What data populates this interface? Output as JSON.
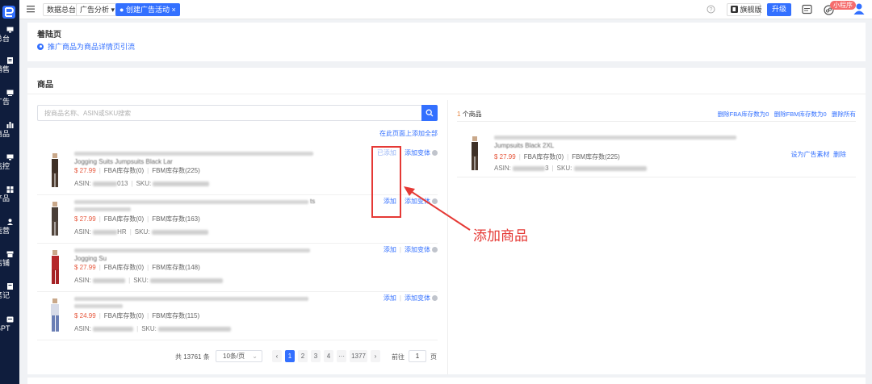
{
  "sidebar": {
    "items": [
      {
        "label": "总台",
        "icon": "monitor-icon"
      },
      {
        "label": "销售",
        "icon": "doc-icon"
      },
      {
        "label": "广告",
        "icon": "screen-icon"
      },
      {
        "label": "商品",
        "icon": "chart-icon"
      },
      {
        "label": "监控",
        "icon": "monitor-icon"
      },
      {
        "label": "产品",
        "icon": "grid-icon"
      },
      {
        "label": "运营",
        "icon": "user-icon"
      },
      {
        "label": "店铺",
        "icon": "store-icon"
      },
      {
        "label": "笔记",
        "icon": "note-icon"
      },
      {
        "label": "GPT",
        "icon": "gpt-icon"
      }
    ]
  },
  "topbar": {
    "crumbs": [
      "数据总台",
      "广告分析",
      "创建广告活动"
    ],
    "edition_label": "旗舰版",
    "upgrade_label": "升级",
    "mini_program_label": "小程序"
  },
  "landing": {
    "title": "着陆页",
    "option": "推广商品为商品详情页引流"
  },
  "products": {
    "title": "商品",
    "search_placeholder": "按商品名称、ASIN或SKU搜索",
    "add_all_label": "在此页面上添加全部",
    "items": [
      {
        "title_tail": "Jogging Suits Jumpsuits Black Lar",
        "price": "$ 27.99",
        "fba": "FBA库存数(0)",
        "fbm": "FBM库存数(225)",
        "asin_label": "ASIN:",
        "asin_frag": "013",
        "sku_label": "SKU:",
        "add": "已添加",
        "variant": "添加变体"
      },
      {
        "title_tail": "ts",
        "price": "$ 27.99",
        "fba": "FBA库存数(0)",
        "fbm": "FBM库存数(163)",
        "asin_label": "ASIN:",
        "asin_frag": "HR",
        "sku_label": "SKU:",
        "add": "添加",
        "variant": "添加变体"
      },
      {
        "title_tail": "Jogging Su",
        "price": "$ 27.99",
        "fba": "FBA库存数(0)",
        "fbm": "FBM库存数(148)",
        "asin_label": "ASIN:",
        "asin_frag": "",
        "sku_label": "SKU:",
        "add": "添加",
        "variant": "添加变体"
      },
      {
        "title_tail": "",
        "price": "$ 24.99",
        "fba": "FBA库存数(0)",
        "fbm": "FBM库存数(115)",
        "asin_label": "ASIN:",
        "asin_frag": "",
        "sku_label": "SKU:",
        "add": "添加",
        "variant": "添加变体"
      }
    ]
  },
  "selected": {
    "count_num": "1",
    "count_label": "个商品",
    "actions": [
      "删除FBA库存数为0",
      "删除FBM库存数为0",
      "删除所有"
    ],
    "item": {
      "title_tail": "Jumpsuits Black 2XL",
      "price": "$ 27.99",
      "fba": "FBA库存数(0)",
      "fbm": "FBM库存数(225)",
      "asin_label": "ASIN:",
      "asin_frag": "3",
      "sku_label": "SKU:",
      "set_material": "设为广告素材",
      "delete": "删除"
    }
  },
  "pagination": {
    "total": "共 13761 条",
    "page_size": "10条/页",
    "pages": [
      "1",
      "2",
      "3",
      "4",
      "···",
      "1377"
    ],
    "goto_label": "前往",
    "goto_value": "1",
    "page_unit": "页"
  },
  "annotation": {
    "text": "添加商品",
    "color": "#e53935"
  },
  "colors": {
    "accent": "#3370ff",
    "price": "#e6553a",
    "sidebar": "#0f1d3d"
  }
}
